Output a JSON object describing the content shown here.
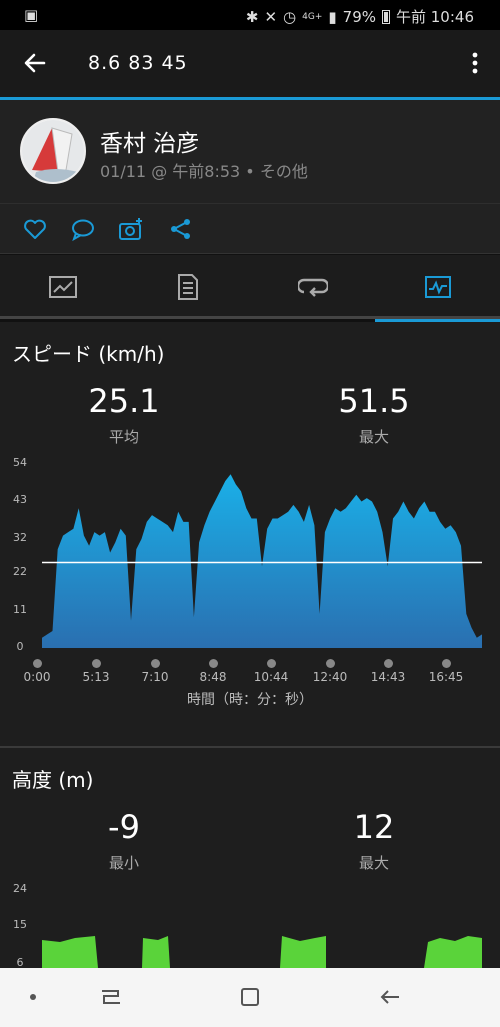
{
  "status_bar": {
    "percent": "79%",
    "time": "午前 10:46",
    "network": "4G+"
  },
  "app_bar": {
    "title": "8.6  83  45"
  },
  "activity": {
    "user_name": "香村 治彦",
    "meta": "01/11 @ 午前8:53 • その他"
  },
  "speed": {
    "title": "スピード (km/h)",
    "avg_value": "25.1",
    "avg_label": "平均",
    "max_value": "51.5",
    "max_label": "最大",
    "x_axis_label": "時間（時：分：秒）"
  },
  "altitude": {
    "title": "高度 (m)",
    "min_value": "-9",
    "min_label": "最小",
    "max_value": "12",
    "max_label": "最大"
  },
  "colors": {
    "accent": "#1a9ad6",
    "speed_fill": "#2596d6",
    "altitude_fill": "#5ad33a"
  },
  "chart_data": [
    {
      "type": "area",
      "title": "スピード (km/h)",
      "xlabel": "時間（時：分：秒）",
      "ylabel": "",
      "yticks": [
        "54",
        "43",
        "32",
        "22",
        "11",
        "0"
      ],
      "xticks": [
        "0:00",
        "5:13",
        "7:10",
        "8:48",
        "10:44",
        "12:40",
        "14:43",
        "16:45"
      ],
      "ylim": [
        0,
        54
      ],
      "reference_line": 25.1,
      "series": [
        {
          "values": [
            3,
            4,
            5,
            29,
            33,
            34,
            35,
            41,
            33,
            30,
            34,
            33,
            34,
            28,
            31,
            35,
            33,
            8,
            29,
            32,
            37,
            39,
            38,
            37,
            36,
            34,
            40,
            37,
            37,
            9,
            31,
            36,
            40,
            43,
            46,
            49,
            51,
            48,
            46,
            41,
            38,
            38,
            24,
            35,
            38,
            38,
            39,
            40,
            42,
            40,
            37,
            42,
            36,
            10,
            34,
            38,
            41,
            40,
            41,
            43,
            45,
            43,
            44,
            43,
            40,
            34,
            24,
            38,
            40,
            43,
            40,
            38,
            41,
            43,
            40,
            40,
            37,
            35,
            36,
            34,
            30,
            10,
            6,
            3,
            4
          ]
        }
      ]
    },
    {
      "type": "area",
      "title": "高度 (m)",
      "yticks": [
        "24",
        "15",
        "6"
      ],
      "ylim": [
        6,
        24
      ]
    }
  ]
}
